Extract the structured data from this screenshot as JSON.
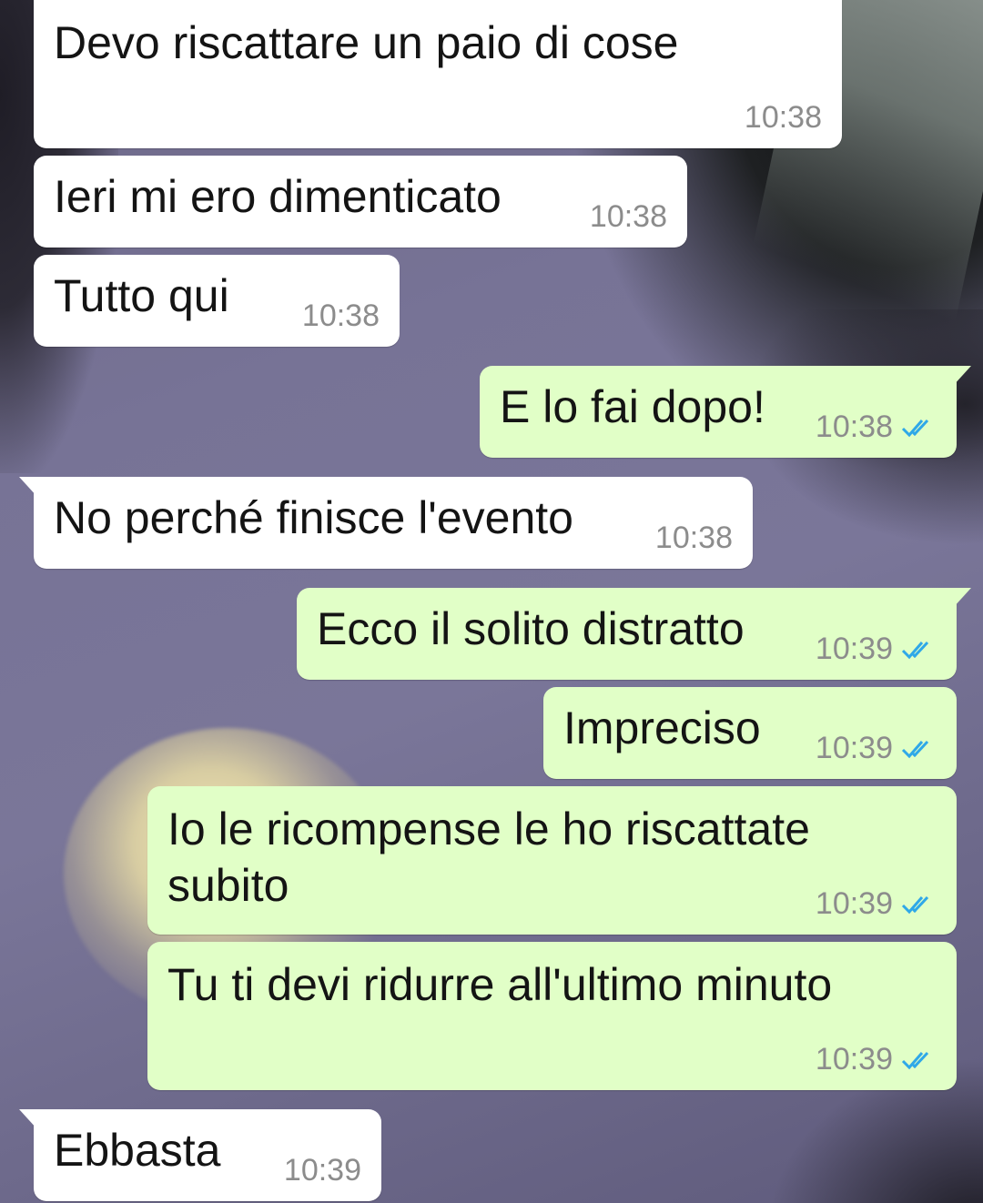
{
  "colors": {
    "incoming_bubble": "#ffffff",
    "outgoing_bubble": "#e1ffc7",
    "timestamp": "#8c8c8c",
    "read_ticks": "#2fa8e8"
  },
  "messages": [
    {
      "direction": "in",
      "text": "Devo riscattare un paio di cose",
      "time": "10:38"
    },
    {
      "direction": "in",
      "text": "Ieri mi ero dimenticato",
      "time": "10:38"
    },
    {
      "direction": "in",
      "text": "Tutto qui",
      "time": "10:38"
    },
    {
      "direction": "out",
      "text": "E lo fai dopo!",
      "time": "10:38",
      "status_icon": "double-check-read-icon"
    },
    {
      "direction": "in",
      "text": "No perché finisce l'evento",
      "time": "10:38"
    },
    {
      "direction": "out",
      "text": "Ecco il solito distratto",
      "time": "10:39",
      "status_icon": "double-check-read-icon"
    },
    {
      "direction": "out",
      "text": "Impreciso",
      "time": "10:39",
      "status_icon": "double-check-read-icon"
    },
    {
      "direction": "out",
      "text": "Io le ricompense le ho riscattate\nsubito",
      "time": "10:39",
      "status_icon": "double-check-read-icon"
    },
    {
      "direction": "out",
      "text": "Tu ti devi ridurre all'ultimo minuto",
      "time": "10:39",
      "status_icon": "double-check-read-icon"
    },
    {
      "direction": "in",
      "text": "Ebbasta",
      "time": "10:39"
    }
  ]
}
